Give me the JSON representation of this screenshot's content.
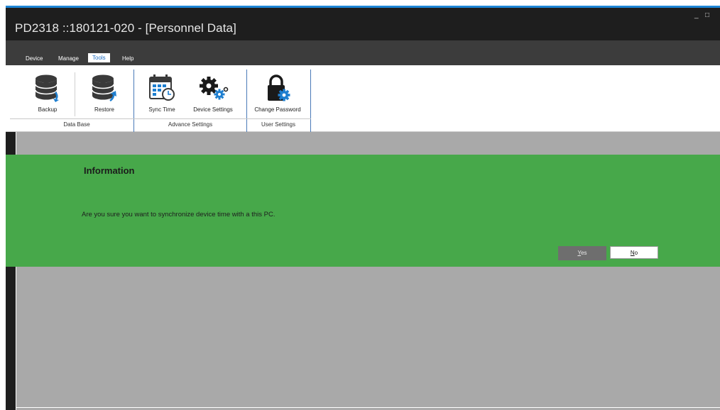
{
  "window": {
    "title": "PD2318 ::180121-020 - [Personnel Data]",
    "minimize_glyph": "_",
    "maximize_glyph": "□"
  },
  "menu": {
    "items": [
      {
        "label": "Device",
        "active": false
      },
      {
        "label": "Manage",
        "active": false
      },
      {
        "label": "Tools",
        "active": true
      },
      {
        "label": "Help",
        "active": false
      }
    ]
  },
  "ribbon": {
    "buttons": {
      "backup": {
        "label": "Backup",
        "icon": "database-download-icon"
      },
      "restore": {
        "label": "Restore",
        "icon": "database-restore-icon"
      },
      "sync_time": {
        "label": "Sync Time",
        "icon": "calendar-clock-icon"
      },
      "device_settings": {
        "label": "Device Settings",
        "icon": "gears-icon"
      },
      "change_password": {
        "label": "Change Password",
        "icon": "lock-gear-icon"
      }
    },
    "groups": {
      "database": "Data Base",
      "advance": "Advance Settings",
      "user": "User Settings"
    }
  },
  "dialog": {
    "title": "Information",
    "message": "Are you sure you want to synchronize device time with a this PC.",
    "yes_first": "Y",
    "yes_rest": "es",
    "no_first": "N",
    "no_rest": "o"
  },
  "colors": {
    "accent_blue": "#1e86d6",
    "dialog_green": "#47a84a",
    "workspace_gray": "#a9a9a9",
    "titlebar_dark": "#1e1e1e",
    "menubar_gray": "#3c3c3c",
    "tools_tab_text": "#1e6cc0"
  }
}
